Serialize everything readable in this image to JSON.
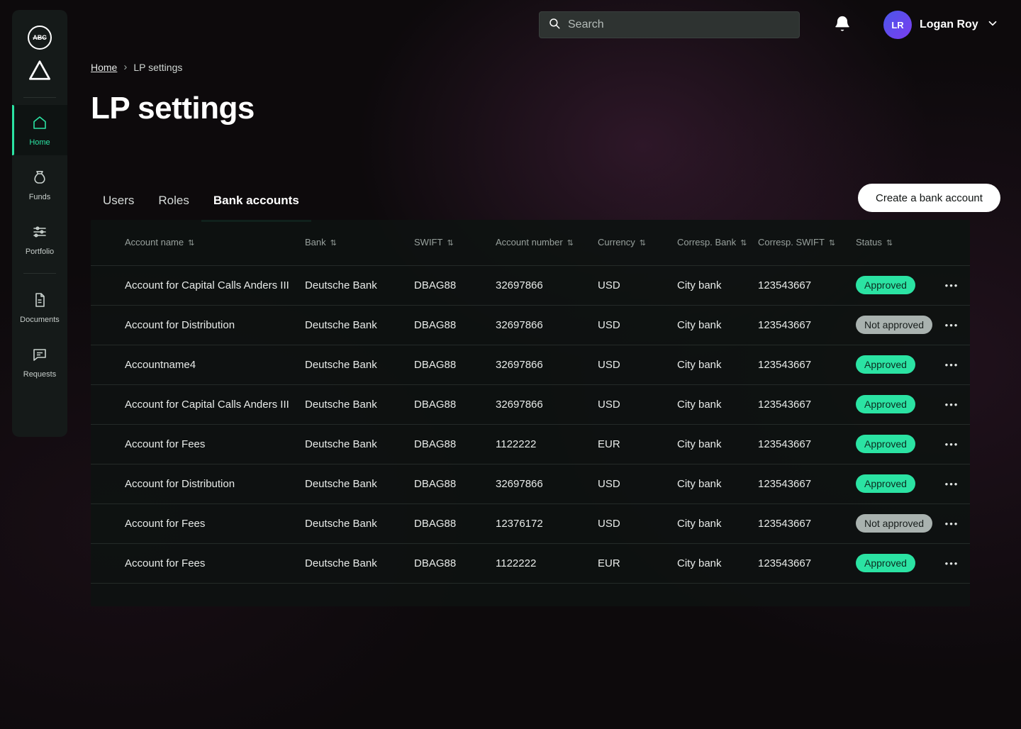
{
  "brand": {
    "logo_text": "ABC"
  },
  "topbar": {
    "search_placeholder": "Search",
    "user": {
      "initials": "LR",
      "name": "Logan Roy"
    }
  },
  "breadcrumb": {
    "home": "Home",
    "current": "LP settings"
  },
  "page": {
    "title": "LP settings"
  },
  "sidebar": {
    "items": [
      {
        "label": "Home",
        "active": true
      },
      {
        "label": "Funds",
        "active": false
      },
      {
        "label": "Portfolio",
        "active": false
      },
      {
        "label": "Documents",
        "active": false
      },
      {
        "label": "Requests",
        "active": false
      }
    ]
  },
  "tabs": [
    {
      "label": "Users",
      "active": false
    },
    {
      "label": "Roles",
      "active": false
    },
    {
      "label": "Bank accounts",
      "active": true
    }
  ],
  "actions": {
    "create_bank_account": "Create a bank account"
  },
  "table": {
    "columns": [
      {
        "label": "Account name",
        "sortable": true
      },
      {
        "label": "Bank",
        "sortable": true
      },
      {
        "label": "SWIFT",
        "sortable": true
      },
      {
        "label": "Account number",
        "sortable": true
      },
      {
        "label": "Currency",
        "sortable": true
      },
      {
        "label": "Corresp. Bank",
        "sortable": true
      },
      {
        "label": "Corresp. SWIFT",
        "sortable": true
      },
      {
        "label": "Status",
        "sortable": true
      }
    ],
    "rows": [
      {
        "account_name": "Account for Capital Calls Anders III",
        "bank": "Deutsche Bank",
        "swift": "DBAG88",
        "account_number": "32697866",
        "currency": "USD",
        "corresp_bank": "City bank",
        "corresp_swift": "123543667",
        "status": "Approved"
      },
      {
        "account_name": "Account for Distribution",
        "bank": "Deutsche Bank",
        "swift": "DBAG88",
        "account_number": "32697866",
        "currency": "USD",
        "corresp_bank": "City bank",
        "corresp_swift": "123543667",
        "status": "Not approved"
      },
      {
        "account_name": "Accountname4",
        "bank": "Deutsche Bank",
        "swift": "DBAG88",
        "account_number": "32697866",
        "currency": "USD",
        "corresp_bank": "City bank",
        "corresp_swift": "123543667",
        "status": "Approved"
      },
      {
        "account_name": "Account for Capital Calls Anders III",
        "bank": "Deutsche Bank",
        "swift": "DBAG88",
        "account_number": "32697866",
        "currency": "USD",
        "corresp_bank": "City bank",
        "corresp_swift": "123543667",
        "status": "Approved"
      },
      {
        "account_name": "Account for Fees",
        "bank": "Deutsche Bank",
        "swift": "DBAG88",
        "account_number": "1122222",
        "currency": "EUR",
        "corresp_bank": "City bank",
        "corresp_swift": "123543667",
        "status": "Approved"
      },
      {
        "account_name": "Account for Distribution",
        "bank": "Deutsche Bank",
        "swift": "DBAG88",
        "account_number": "32697866",
        "currency": "USD",
        "corresp_bank": "City bank",
        "corresp_swift": "123543667",
        "status": "Approved"
      },
      {
        "account_name": "Account for Fees",
        "bank": "Deutsche Bank",
        "swift": "DBAG88",
        "account_number": "12376172",
        "currency": "USD",
        "corresp_bank": "City bank",
        "corresp_swift": "123543667",
        "status": "Not approved"
      },
      {
        "account_name": "Account for Fees",
        "bank": "Deutsche Bank",
        "swift": "DBAG88",
        "account_number": "1122222",
        "currency": "EUR",
        "corresp_bank": "City bank",
        "corresp_swift": "123543667",
        "status": "Approved"
      }
    ]
  },
  "status": {
    "approved": "Approved",
    "not_approved": "Not approved"
  },
  "icons": {
    "row_actions": "•••",
    "sort": "⇅"
  },
  "colors": {
    "accent_green": "#2be3a3",
    "approved_badge_bg": "#2be3a3",
    "not_approved_badge_bg": "#a9b2af",
    "page_background": "#0d0a0c",
    "panel_background": "#0e1211"
  }
}
